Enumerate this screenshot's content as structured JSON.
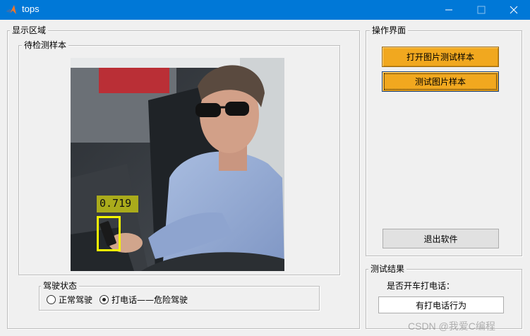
{
  "window": {
    "title": "tops",
    "icon": "matlab-icon",
    "controls": [
      "minimize-icon",
      "maximize-icon",
      "close-icon"
    ]
  },
  "display_area": {
    "title": "显示区域",
    "sample_panel": {
      "title": "待检测样本",
      "detection": {
        "score": "0.719",
        "box_color": "#f5f500"
      }
    },
    "driving_state": {
      "title": "驾驶状态",
      "options": [
        {
          "label": "正常驾驶",
          "checked": false
        },
        {
          "label": "打电话——危险驾驶",
          "checked": true
        }
      ]
    }
  },
  "operation_panel": {
    "title": "操作界面",
    "open_button": "打开图片测试样本",
    "test_button": "测试图片样本",
    "exit_button": "退出软件",
    "accent": "#f1a81f"
  },
  "result_panel": {
    "title": "测试结果",
    "question": "是否开车打电话：",
    "answer": "有打电话行为"
  },
  "watermark": "CSDN @我爱C编程"
}
